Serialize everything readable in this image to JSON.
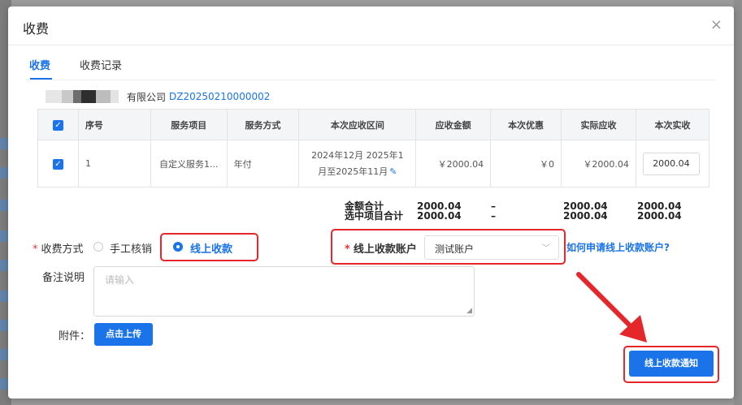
{
  "dialog": {
    "title": "收费",
    "close_icon": "×"
  },
  "tabs": [
    {
      "label": "收费",
      "active": true
    },
    {
      "label": "收费记录",
      "active": false
    }
  ],
  "company": {
    "name_suffix": "有限公司",
    "code": "DZ20250210000002"
  },
  "table": {
    "headers": [
      "序号",
      "服务项目",
      "服务方式",
      "本次应收区间",
      "应收金额",
      "本次优惠",
      "实际应收",
      "本次实收"
    ],
    "row": {
      "checked": true,
      "index": "1",
      "service_item": "自定义服务1...",
      "service_mode": "年付",
      "period_line1": "2024年12月 2025年1",
      "period_line2": "月至2025年11月",
      "receivable": "￥2000.04",
      "discount": "￥0",
      "actual": "￥2000.04",
      "received_input": "2000.04"
    }
  },
  "totals": {
    "label_total": "金额合计",
    "label_selected": "选中项目合计",
    "receivable_total": "2000.04",
    "receivable_selected": "2000.04",
    "discount_total": "–",
    "discount_selected": "–",
    "actual_total": "2000.04",
    "actual_selected": "2000.04",
    "received_total": "2000.04",
    "received_selected": "2000.04"
  },
  "form": {
    "payment_method_label": "收费方式",
    "option_manual": "手工核销",
    "option_online": "线上收款",
    "selected_option": "线上收款",
    "account_label": "线上收款账户",
    "account_value": "测试账户",
    "account_help_link": "如何申请线上收款账户?",
    "remark_label": "备注说明",
    "remark_placeholder": "请输入",
    "attachment_label": "附件：",
    "upload_button": "点击上传",
    "notify_button": "线上收款通知",
    "required_mark": "*"
  },
  "colors": {
    "accent": "#1a73e8",
    "highlight": "#e5262b"
  }
}
